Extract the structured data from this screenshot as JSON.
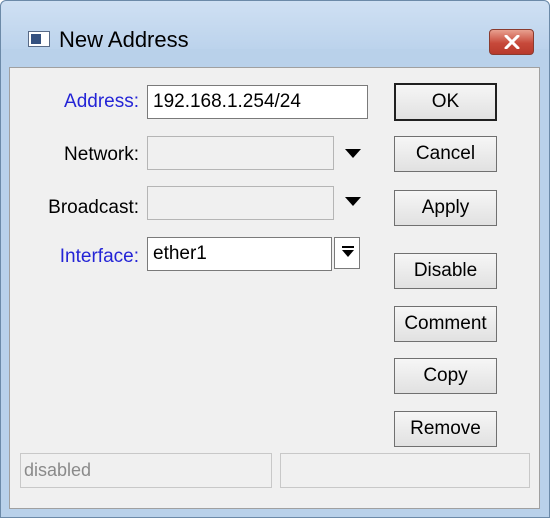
{
  "window": {
    "title": "New Address"
  },
  "form": {
    "address": {
      "label": "Address:",
      "value": "192.168.1.254/24"
    },
    "network": {
      "label": "Network:",
      "value": ""
    },
    "broadcast": {
      "label": "Broadcast:",
      "value": ""
    },
    "interface": {
      "label": "Interface:",
      "value": "ether1"
    }
  },
  "buttons": {
    "ok": "OK",
    "cancel": "Cancel",
    "apply": "Apply",
    "disable": "Disable",
    "comment": "Comment",
    "copy": "Copy",
    "remove": "Remove"
  },
  "status": {
    "left": "disabled",
    "right": ""
  },
  "colors": {
    "field_label_blue": "#2424d6",
    "close_button_red": "#c7493a"
  }
}
